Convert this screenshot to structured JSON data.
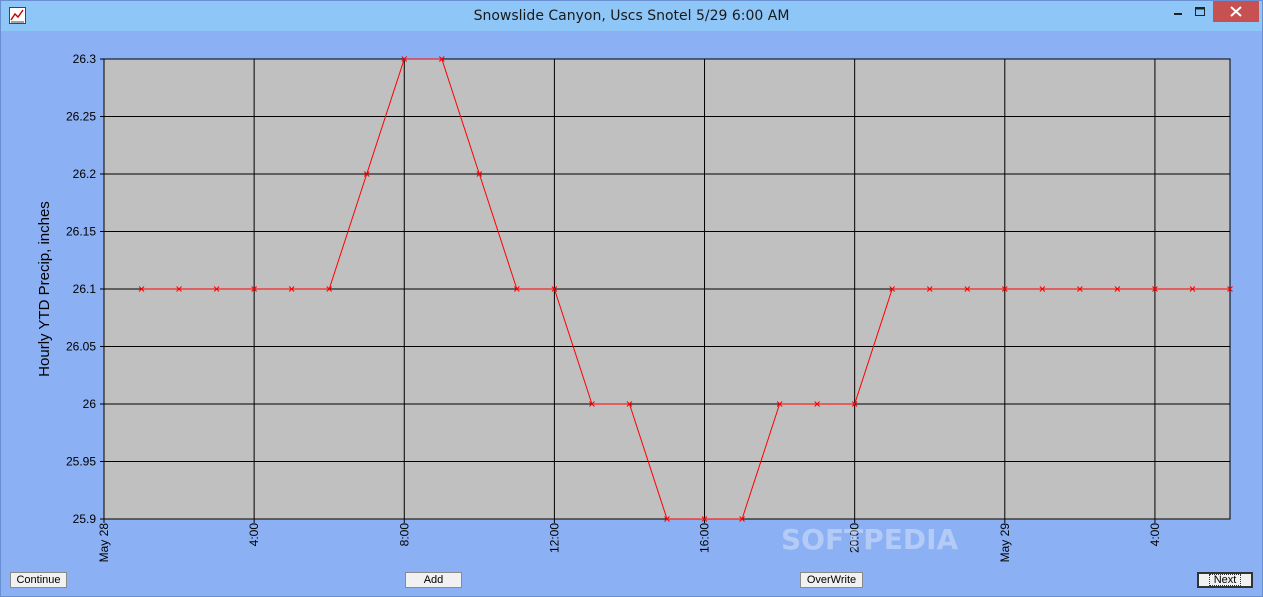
{
  "window": {
    "title": "Snowslide Canyon, Uscs Snotel 5/29 6:00 AM",
    "icon": "chart-icon",
    "controls": {
      "minimize": "minimize-icon",
      "maximize": "maximize-icon",
      "close": "close-icon"
    }
  },
  "chart_data": {
    "type": "line",
    "ylabel": "Hourly YTD Precip, inches",
    "xlabel": "",
    "ylim": [
      25.9,
      26.3
    ],
    "yticks": [
      "26.3",
      "26.25",
      "26.2",
      "26.15",
      "26.1",
      "26.05",
      "26",
      "25.95",
      "25.9"
    ],
    "xticks": [
      {
        "hour": 0,
        "label": "May 28"
      },
      {
        "hour": 4,
        "label": "4:00"
      },
      {
        "hour": 8,
        "label": "8:00"
      },
      {
        "hour": 12,
        "label": "12:00"
      },
      {
        "hour": 16,
        "label": "16:00"
      },
      {
        "hour": 20,
        "label": "20:00"
      },
      {
        "hour": 24,
        "label": "May 29"
      },
      {
        "hour": 28,
        "label": "4:00"
      }
    ],
    "xlim_hours": [
      0,
      30
    ],
    "series": [
      {
        "color": "#ff0000",
        "marker": "x",
        "x_hours": [
          1,
          2,
          3,
          4,
          5,
          6,
          7,
          8,
          9,
          10,
          11,
          12,
          13,
          14,
          15,
          16,
          17,
          18,
          19,
          20,
          21,
          22,
          23,
          24,
          25,
          26,
          27,
          28,
          29,
          30
        ],
        "values": [
          26.1,
          26.1,
          26.1,
          26.1,
          26.1,
          26.1,
          26.2,
          26.3,
          26.3,
          26.2,
          26.1,
          26.1,
          26.0,
          26.0,
          25.9,
          25.9,
          25.9,
          26.0,
          26.0,
          26.0,
          26.1,
          26.1,
          26.1,
          26.1,
          26.1,
          26.1,
          26.1,
          26.1,
          26.1,
          26.1
        ]
      }
    ],
    "grid": true,
    "plot_background": "#c0c0c0",
    "frame_background": "#8cb0f4"
  },
  "buttons": {
    "continue": "Continue",
    "add": "Add",
    "overwrite": "OverWrite",
    "next": "Next"
  },
  "watermark": "SOFTPEDIA"
}
